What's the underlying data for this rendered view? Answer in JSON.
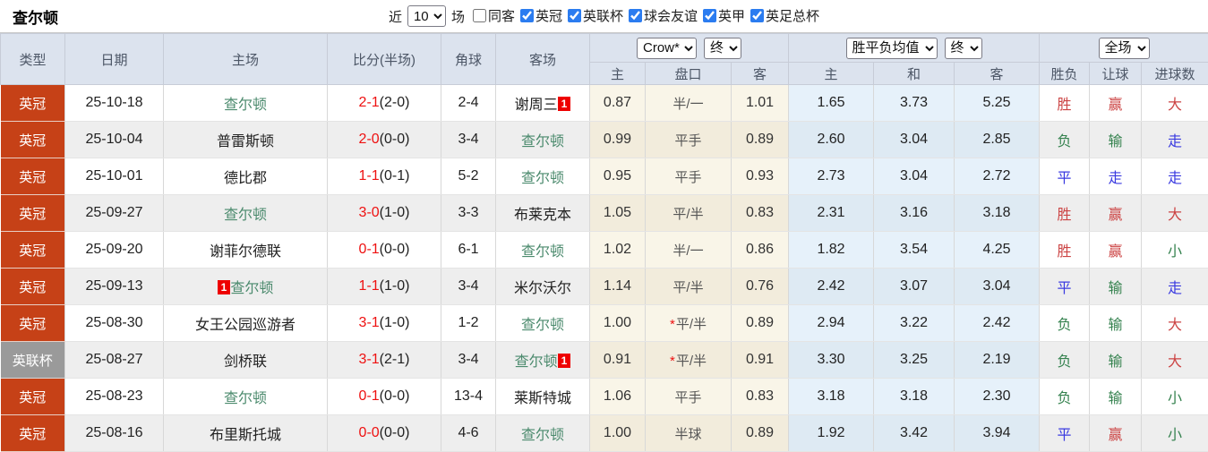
{
  "page_title": "查尔顿",
  "topbar": {
    "recent_label": "近",
    "recent_count": "10",
    "matches_label": "场",
    "filters": [
      {
        "label": "同客",
        "checked": false
      },
      {
        "label": "英冠",
        "checked": true
      },
      {
        "label": "英联杯",
        "checked": true
      },
      {
        "label": "球会友谊",
        "checked": true
      },
      {
        "label": "英甲",
        "checked": true
      },
      {
        "label": "英足总杯",
        "checked": true
      }
    ]
  },
  "table": {
    "static_headers": {
      "type": "类型",
      "date": "日期",
      "home": "主场",
      "score": "比分(半场)",
      "corners": "角球",
      "away": "客场"
    },
    "odds_group": {
      "company_select": "Crow*",
      "time_select": "终",
      "subcols": [
        "主",
        "盘口",
        "客"
      ]
    },
    "avg_group": {
      "select": "胜平负均值",
      "time_select": "终",
      "subcols": [
        "主",
        "和",
        "客"
      ]
    },
    "result_group": {
      "select": "全场",
      "subcols": [
        "胜负",
        "让球",
        "进球数"
      ]
    },
    "rows": [
      {
        "league": "英冠",
        "league_color": "red",
        "date": "25-10-18",
        "home": {
          "name": "查尔顿",
          "green": true
        },
        "score_ft": "2-1",
        "score_ht": "(2-0)",
        "corners": "2-4",
        "away": {
          "name": "谢周三",
          "green": false,
          "badge": "1",
          "badge_pos": "after"
        },
        "odds": [
          "0.87",
          "半/一",
          "1.01"
        ],
        "handicap_star": false,
        "avg": [
          "1.65",
          "3.73",
          "5.25"
        ],
        "results": [
          {
            "t": "胜",
            "c": "red"
          },
          {
            "t": "赢",
            "c": "red"
          },
          {
            "t": "大",
            "c": "red"
          }
        ]
      },
      {
        "league": "英冠",
        "league_color": "red",
        "date": "25-10-04",
        "home": {
          "name": "普雷斯顿",
          "green": false
        },
        "score_ft": "2-0",
        "score_ht": "(0-0)",
        "corners": "3-4",
        "away": {
          "name": "查尔顿",
          "green": true
        },
        "odds": [
          "0.99",
          "平手",
          "0.89"
        ],
        "handicap_star": false,
        "avg": [
          "2.60",
          "3.04",
          "2.85"
        ],
        "results": [
          {
            "t": "负",
            "c": "green"
          },
          {
            "t": "输",
            "c": "green"
          },
          {
            "t": "走",
            "c": "blue"
          }
        ]
      },
      {
        "league": "英冠",
        "league_color": "red",
        "date": "25-10-01",
        "home": {
          "name": "德比郡",
          "green": false
        },
        "score_ft": "1-1",
        "score_ht": "(0-1)",
        "corners": "5-2",
        "away": {
          "name": "查尔顿",
          "green": true
        },
        "odds": [
          "0.95",
          "平手",
          "0.93"
        ],
        "handicap_star": false,
        "avg": [
          "2.73",
          "3.04",
          "2.72"
        ],
        "results": [
          {
            "t": "平",
            "c": "blue"
          },
          {
            "t": "走",
            "c": "blue"
          },
          {
            "t": "走",
            "c": "blue"
          }
        ]
      },
      {
        "league": "英冠",
        "league_color": "red",
        "date": "25-09-27",
        "home": {
          "name": "查尔顿",
          "green": true
        },
        "score_ft": "3-0",
        "score_ht": "(1-0)",
        "corners": "3-3",
        "away": {
          "name": "布莱克本",
          "green": false
        },
        "odds": [
          "1.05",
          "平/半",
          "0.83"
        ],
        "handicap_star": false,
        "avg": [
          "2.31",
          "3.16",
          "3.18"
        ],
        "results": [
          {
            "t": "胜",
            "c": "red"
          },
          {
            "t": "赢",
            "c": "red"
          },
          {
            "t": "大",
            "c": "red"
          }
        ]
      },
      {
        "league": "英冠",
        "league_color": "red",
        "date": "25-09-20",
        "home": {
          "name": "谢菲尔德联",
          "green": false
        },
        "score_ft": "0-1",
        "score_ht": "(0-0)",
        "corners": "6-1",
        "away": {
          "name": "查尔顿",
          "green": true
        },
        "odds": [
          "1.02",
          "半/一",
          "0.86"
        ],
        "handicap_star": false,
        "avg": [
          "1.82",
          "3.54",
          "4.25"
        ],
        "results": [
          {
            "t": "胜",
            "c": "red"
          },
          {
            "t": "赢",
            "c": "red"
          },
          {
            "t": "小",
            "c": "green"
          }
        ]
      },
      {
        "league": "英冠",
        "league_color": "red",
        "date": "25-09-13",
        "home": {
          "name": "查尔顿",
          "green": true,
          "badge": "1",
          "badge_pos": "before"
        },
        "score_ft": "1-1",
        "score_ht": "(1-0)",
        "corners": "3-4",
        "away": {
          "name": "米尔沃尔",
          "green": false
        },
        "odds": [
          "1.14",
          "平/半",
          "0.76"
        ],
        "handicap_star": false,
        "avg": [
          "2.42",
          "3.07",
          "3.04"
        ],
        "results": [
          {
            "t": "平",
            "c": "blue"
          },
          {
            "t": "输",
            "c": "green"
          },
          {
            "t": "走",
            "c": "blue"
          }
        ]
      },
      {
        "league": "英冠",
        "league_color": "red",
        "date": "25-08-30",
        "home": {
          "name": "女王公园巡游者",
          "green": false
        },
        "score_ft": "3-1",
        "score_ht": "(1-0)",
        "corners": "1-2",
        "away": {
          "name": "查尔顿",
          "green": true
        },
        "odds": [
          "1.00",
          "平/半",
          "0.89"
        ],
        "handicap_star": true,
        "avg": [
          "2.94",
          "3.22",
          "2.42"
        ],
        "results": [
          {
            "t": "负",
            "c": "green"
          },
          {
            "t": "输",
            "c": "green"
          },
          {
            "t": "大",
            "c": "red"
          }
        ]
      },
      {
        "league": "英联杯",
        "league_color": "gray",
        "date": "25-08-27",
        "home": {
          "name": "剑桥联",
          "green": false
        },
        "score_ft": "3-1",
        "score_ht": "(2-1)",
        "corners": "3-4",
        "away": {
          "name": "查尔顿",
          "green": true,
          "badge": "1",
          "badge_pos": "after"
        },
        "odds": [
          "0.91",
          "平/半",
          "0.91"
        ],
        "handicap_star": true,
        "avg": [
          "3.30",
          "3.25",
          "2.19"
        ],
        "results": [
          {
            "t": "负",
            "c": "green"
          },
          {
            "t": "输",
            "c": "green"
          },
          {
            "t": "大",
            "c": "red"
          }
        ]
      },
      {
        "league": "英冠",
        "league_color": "red",
        "date": "25-08-23",
        "home": {
          "name": "查尔顿",
          "green": true
        },
        "score_ft": "0-1",
        "score_ht": "(0-0)",
        "corners": "13-4",
        "away": {
          "name": "莱斯特城",
          "green": false
        },
        "odds": [
          "1.06",
          "平手",
          "0.83"
        ],
        "handicap_star": false,
        "avg": [
          "3.18",
          "3.18",
          "2.30"
        ],
        "results": [
          {
            "t": "负",
            "c": "green"
          },
          {
            "t": "输",
            "c": "green"
          },
          {
            "t": "小",
            "c": "green"
          }
        ]
      },
      {
        "league": "英冠",
        "league_color": "red",
        "date": "25-08-16",
        "home": {
          "name": "布里斯托城",
          "green": false
        },
        "score_ft": "0-0",
        "score_ht": "(0-0)",
        "corners": "4-6",
        "away": {
          "name": "查尔顿",
          "green": true
        },
        "odds": [
          "1.00",
          "半球",
          "0.89"
        ],
        "handicap_star": false,
        "avg": [
          "1.92",
          "3.42",
          "3.94"
        ],
        "results": [
          {
            "t": "平",
            "c": "blue"
          },
          {
            "t": "赢",
            "c": "red"
          },
          {
            "t": "小",
            "c": "green"
          }
        ]
      }
    ]
  },
  "colors": {
    "league_red_bg": "#c64117",
    "league_gray_bg": "#9a9a9a",
    "header_bg": "#dce3ee",
    "team_green": "#4b8a6d",
    "score_red": "#ee1111",
    "result_red": "#cc4444",
    "result_green": "#35824f",
    "result_blue": "#3a3ae0",
    "odds_col_bg": "#f8f2e2",
    "avg_col_bg": "#e2eff9"
  }
}
